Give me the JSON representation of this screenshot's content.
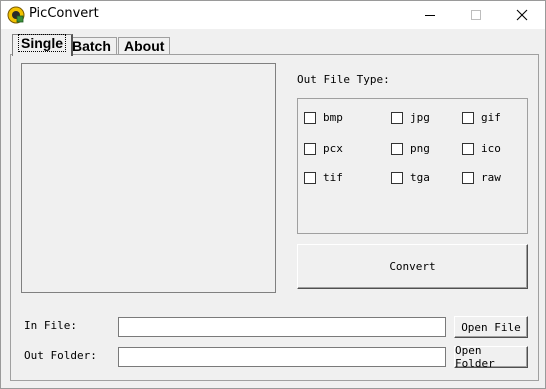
{
  "window": {
    "title": "PicConvert"
  },
  "tabs": [
    {
      "label": "Single"
    },
    {
      "label": "Batch"
    },
    {
      "label": "About"
    }
  ],
  "single": {
    "out_file_type_label": "Out File Type:",
    "types": [
      {
        "label": "bmp",
        "checked": false
      },
      {
        "label": "jpg",
        "checked": false
      },
      {
        "label": "gif",
        "checked": false
      },
      {
        "label": "pcx",
        "checked": false
      },
      {
        "label": "png",
        "checked": false
      },
      {
        "label": "ico",
        "checked": false
      },
      {
        "label": "tif",
        "checked": false
      },
      {
        "label": "tga",
        "checked": false
      },
      {
        "label": "raw",
        "checked": false
      }
    ],
    "convert_label": "Convert",
    "in_file_label": "In File:",
    "in_file_value": "",
    "open_file_label": "Open File",
    "out_folder_label": "Out Folder:",
    "out_folder_value": "",
    "open_folder_label": "Open Folder"
  }
}
